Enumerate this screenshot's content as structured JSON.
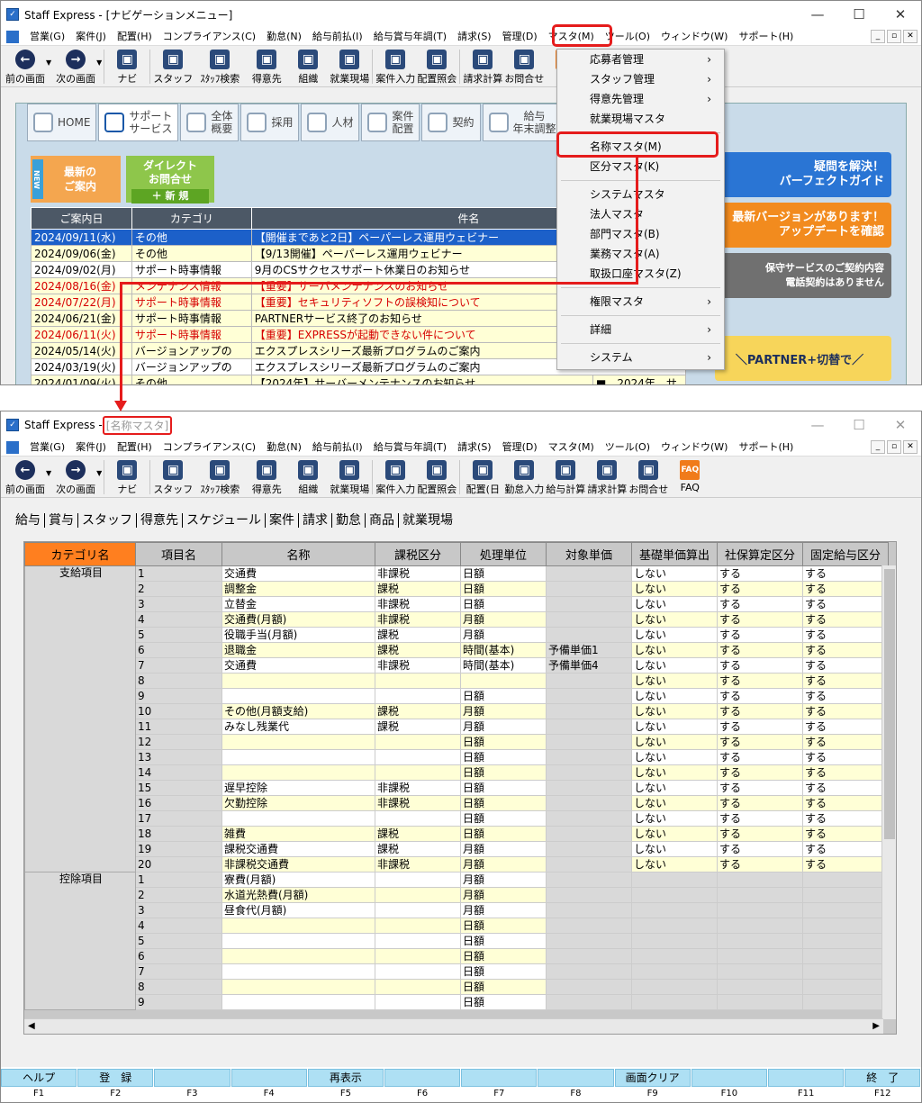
{
  "win1": {
    "title": "Staff Express - [ナビゲーションメニュー]",
    "menu": [
      "営業(G)",
      "案件(J)",
      "配置(H)",
      "コンプライアンス(C)",
      "勤怠(N)",
      "給与前払(I)",
      "給与賞与年調(T)",
      "請求(S)",
      "管理(D)",
      "マスタ(M)",
      "ツール(O)",
      "ウィンドウ(W)",
      "サポート(H)"
    ],
    "toolbar": [
      "前の画面",
      "次の画面",
      "ナビ",
      "スタッフ",
      "ｽﾀｯﾌ検索",
      "得意先",
      "組織",
      "就業現場",
      "案件入力",
      "配置照会",
      "請求計算",
      "お問合せ",
      "FAQ"
    ],
    "navtabs": [
      "HOME",
      "サポート\nサービス",
      "全体\n概要",
      "採用",
      "人材",
      "案件\n配置",
      "契約",
      "給与\n年末調整",
      "請求\n入金",
      "経営\n分析"
    ],
    "news_btn": "最新の\nご案内",
    "news_new": "NEW",
    "direct_btn": "ダイレクト\nお問合せ",
    "direct_new": "＋ 新 規",
    "news_headers": [
      "ご案内日",
      "カテゴリ",
      "件名"
    ],
    "news": [
      {
        "date": "2024/09/11(水)",
        "cat": "その他",
        "subject": "【開催まであと2日】ペーパーレス運用ウェビナー",
        "style": "sel"
      },
      {
        "date": "2024/09/06(金)",
        "cat": "その他",
        "subject": "【9/13開催】ペーパーレス運用ウェビナー",
        "style": "y"
      },
      {
        "date": "2024/09/02(月)",
        "cat": "サポート時事情報",
        "subject": "9月のCSサクセスサポート休業日のお知らせ",
        "style": "w"
      },
      {
        "date": "2024/08/16(金)",
        "cat": "メンテナンス情報",
        "subject": "【重要】サーバメンテナンスのお知らせ",
        "style": "red"
      },
      {
        "date": "2024/07/22(月)",
        "cat": "サポート時事情報",
        "subject": "【重要】セキュリティソフトの誤検知について",
        "style": "red"
      },
      {
        "date": "2024/06/21(金)",
        "cat": "サポート時事情報",
        "subject": "PARTNERサービス終了のお知らせ",
        "style": "y"
      },
      {
        "date": "2024/06/11(火)",
        "cat": "サポート時事情報",
        "subject": "【重要】EXPRESSが起動できない件について",
        "style": "red"
      },
      {
        "date": "2024/05/14(火)",
        "cat": "バージョンアップの",
        "subject": "エクスプレスシリーズ最新プログラムのご案内",
        "style": "y"
      },
      {
        "date": "2024/03/19(火)",
        "cat": "バージョンアップの",
        "subject": "エクスプレスシリーズ最新プログラムのご案内",
        "style": "w"
      },
      {
        "date": "2024/01/09(火)",
        "cat": "その他",
        "subject": "【2024年】サーバーメンテナンスのお知らせ",
        "style": "y"
      }
    ],
    "news_extra": "■　2024年　サ",
    "banners": [
      "疑問を解決！\nパーフェクトガイド",
      "最新バージョンがあります！\nアップデートを確認",
      "保守サービスのご契約内容\n電話契約はありません",
      "＼PARTNER+切替で／"
    ],
    "dropdown": [
      "応募者管理",
      "スタッフ管理",
      "得意先管理",
      "就業現場マスタ",
      "名称マスタ(M)",
      "区分マスタ(K)",
      "システムマスタ",
      "法人マスタ",
      "部門マスタ(B)",
      "業務マスタ(A)",
      "取扱口座マスタ(Z)",
      "権限マスタ",
      "詳細",
      "システム"
    ]
  },
  "win2": {
    "title_prefix": "Staff Express - ",
    "title_name": "[名称マスタ]",
    "menu": [
      "営業(G)",
      "案件(J)",
      "配置(H)",
      "コンプライアンス(C)",
      "勤怠(N)",
      "給与前払(I)",
      "給与賞与年調(T)",
      "請求(S)",
      "管理(D)",
      "マスタ(M)",
      "ツール(O)",
      "ウィンドウ(W)",
      "サポート(H)"
    ],
    "toolbar": [
      "前の画面",
      "次の画面",
      "ナビ",
      "スタッフ",
      "ｽﾀｯﾌ検索",
      "得意先",
      "組織",
      "就業現場",
      "案件入力",
      "配置照会",
      "配置(日",
      "勤怠入力",
      "給与計算",
      "請求計算",
      "お問合せ",
      "FAQ"
    ],
    "tabs": [
      "給与",
      "賞与",
      "スタッフ",
      "得意先",
      "スケジュール",
      "案件",
      "請求",
      "勤怠",
      "商品",
      "就業現場"
    ],
    "headers": [
      "カテゴリ名",
      "項目名",
      "名称",
      "課税区分",
      "処理単位",
      "対象単価",
      "基礎単価算出",
      "社保算定区分",
      "固定給与区分"
    ],
    "group1": "支給項目",
    "group2": "控除項目",
    "rows1": [
      [
        "1",
        "交通費",
        "非課税",
        "日額",
        "",
        "しない",
        "する",
        "する"
      ],
      [
        "2",
        "調整金",
        "課税",
        "日額",
        "",
        "しない",
        "する",
        "する"
      ],
      [
        "3",
        "立替金",
        "非課税",
        "日額",
        "",
        "しない",
        "する",
        "する"
      ],
      [
        "4",
        "交通費(月額)",
        "非課税",
        "月額",
        "",
        "しない",
        "する",
        "する"
      ],
      [
        "5",
        "役職手当(月額)",
        "課税",
        "月額",
        "",
        "しない",
        "する",
        "する"
      ],
      [
        "6",
        "退職金",
        "課税",
        "時間(基本)",
        "予備単価1",
        "しない",
        "する",
        "する"
      ],
      [
        "7",
        "交通費",
        "非課税",
        "時間(基本)",
        "予備単価4",
        "しない",
        "する",
        "する"
      ],
      [
        "8",
        "",
        "",
        "",
        "",
        "しない",
        "する",
        "する"
      ],
      [
        "9",
        "",
        "",
        "日額",
        "",
        "しない",
        "する",
        "する"
      ],
      [
        "10",
        "その他(月額支給)",
        "課税",
        "月額",
        "",
        "しない",
        "する",
        "する"
      ],
      [
        "11",
        "みなし残業代",
        "課税",
        "月額",
        "",
        "しない",
        "する",
        "する"
      ],
      [
        "12",
        "",
        "",
        "日額",
        "",
        "しない",
        "する",
        "する"
      ],
      [
        "13",
        "",
        "",
        "日額",
        "",
        "しない",
        "する",
        "する"
      ],
      [
        "14",
        "",
        "",
        "日額",
        "",
        "しない",
        "する",
        "する"
      ],
      [
        "15",
        "遅早控除",
        "非課税",
        "日額",
        "",
        "しない",
        "する",
        "する"
      ],
      [
        "16",
        "欠勤控除",
        "非課税",
        "日額",
        "",
        "しない",
        "する",
        "する"
      ],
      [
        "17",
        "",
        "",
        "日額",
        "",
        "しない",
        "する",
        "する"
      ],
      [
        "18",
        "雑費",
        "課税",
        "日額",
        "",
        "しない",
        "する",
        "する"
      ],
      [
        "19",
        "課税交通費",
        "課税",
        "月額",
        "",
        "しない",
        "する",
        "する"
      ],
      [
        "20",
        "非課税交通費",
        "非課税",
        "月額",
        "",
        "しない",
        "する",
        "する"
      ]
    ],
    "rows2": [
      [
        "1",
        "寮費(月額)",
        "",
        "月額"
      ],
      [
        "2",
        "水道光熱費(月額)",
        "",
        "月額"
      ],
      [
        "3",
        "昼食代(月額)",
        "",
        "月額"
      ],
      [
        "4",
        "",
        "",
        "日額"
      ],
      [
        "5",
        "",
        "",
        "日額"
      ],
      [
        "6",
        "",
        "",
        "日額"
      ],
      [
        "7",
        "",
        "",
        "日額"
      ],
      [
        "8",
        "",
        "",
        "日額"
      ],
      [
        "9",
        "",
        "",
        "日額"
      ]
    ],
    "fkeys": [
      {
        "label": "ヘルプ",
        "key": "F1"
      },
      {
        "label": "登　録",
        "key": "F2"
      },
      {
        "label": "",
        "key": "F3"
      },
      {
        "label": "",
        "key": "F4"
      },
      {
        "label": "再表示",
        "key": "F5"
      },
      {
        "label": "",
        "key": "F6"
      },
      {
        "label": "",
        "key": "F7"
      },
      {
        "label": "",
        "key": "F8"
      },
      {
        "label": "画面クリア",
        "key": "F9"
      },
      {
        "label": "",
        "key": "F10"
      },
      {
        "label": "",
        "key": "F11"
      },
      {
        "label": "終　了",
        "key": "F12"
      }
    ]
  },
  "colors": {
    "accent": "#e51c1c",
    "header_orange": "#ff7f1f",
    "row_yellow": "#ffffd6",
    "fkey": "#aee0f4",
    "select_blue": "#1c60c9"
  }
}
